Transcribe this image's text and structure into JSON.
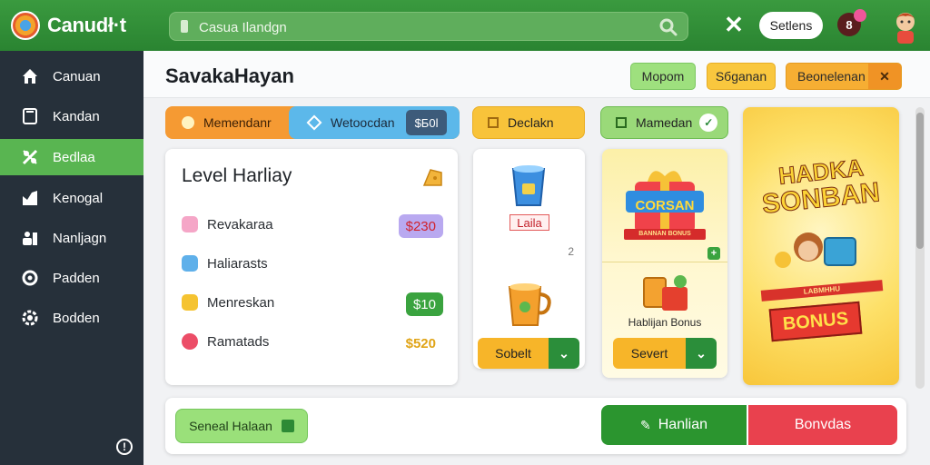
{
  "topbar": {
    "brand": "Canudł·t",
    "search_placeholder": "Casua Ilandgn",
    "settings_label": "Setlens",
    "notif_count": "8"
  },
  "sidebar": {
    "items": [
      {
        "label": "Canuan",
        "icon": "home-icon"
      },
      {
        "label": "Kandan",
        "icon": "document-icon"
      },
      {
        "label": "Bedlaa",
        "icon": "tools-icon"
      },
      {
        "label": "Kenogal",
        "icon": "chart-icon"
      },
      {
        "label": "Nanljagn",
        "icon": "users-icon"
      },
      {
        "label": "Padden",
        "icon": "sync-icon"
      },
      {
        "label": "Bodden",
        "icon": "settings-icon"
      }
    ],
    "active_index": 2
  },
  "header": {
    "title": "SavakaHayan",
    "btn_green": "Mopom",
    "btn_yellow": "Sбganan",
    "btn_orange": "Beonelenan"
  },
  "tabs": {
    "orange": "Memendanr",
    "blue": "Wetoocdan",
    "badge": "$Б0l",
    "yellow": "Declakn",
    "green": "Mamedan"
  },
  "level": {
    "title": "Level Harliay",
    "rows": [
      {
        "label": "Revakaraa",
        "value": "$230"
      },
      {
        "label": "Haliarasts",
        "value": ""
      },
      {
        "label": "Menreskan",
        "value": "$10"
      },
      {
        "label": "Ramatads",
        "value": "$520"
      }
    ]
  },
  "product": {
    "label": "Laila",
    "number": "2",
    "btn": "Sobelt"
  },
  "promo": {
    "banner_top": "CORSAN",
    "banner_sub": "BANNAN BONUS",
    "caption": "Hablijan Bonus",
    "btn": "Severt"
  },
  "bonus_banner": {
    "line1": "HADKA",
    "line2": "SONBAN",
    "ribbon_small": "LABMHHU",
    "ribbon": "BONUS"
  },
  "bottom": {
    "left_btn": "Seneal Halaan",
    "mid_btn": "Hanlian",
    "right_btn": "Bonvdas"
  }
}
